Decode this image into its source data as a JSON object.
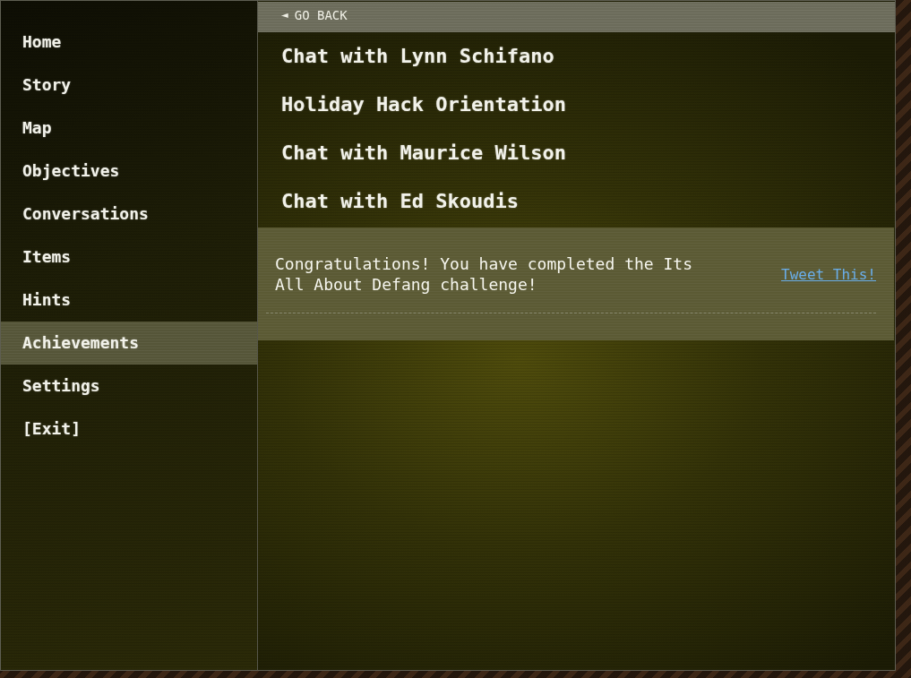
{
  "sidebar": {
    "items": [
      {
        "label": "Home",
        "selected": false
      },
      {
        "label": "Story",
        "selected": false
      },
      {
        "label": "Map",
        "selected": false
      },
      {
        "label": "Objectives",
        "selected": false
      },
      {
        "label": "Conversations",
        "selected": false
      },
      {
        "label": "Items",
        "selected": false
      },
      {
        "label": "Hints",
        "selected": false
      },
      {
        "label": "Achievements",
        "selected": true
      },
      {
        "label": "Settings",
        "selected": false
      },
      {
        "label": "[Exit]",
        "selected": false
      }
    ]
  },
  "back_button": {
    "icon": "◄",
    "label": "GO BACK"
  },
  "conversations": [
    "Chat with Lynn Schifano",
    "Holiday Hack Orientation",
    "Chat with Maurice Wilson",
    "Chat with Ed Skoudis"
  ],
  "achievement": {
    "message": "Congratulations! You have completed the Its All About Defang challenge!",
    "link": "Tweet This!"
  }
}
